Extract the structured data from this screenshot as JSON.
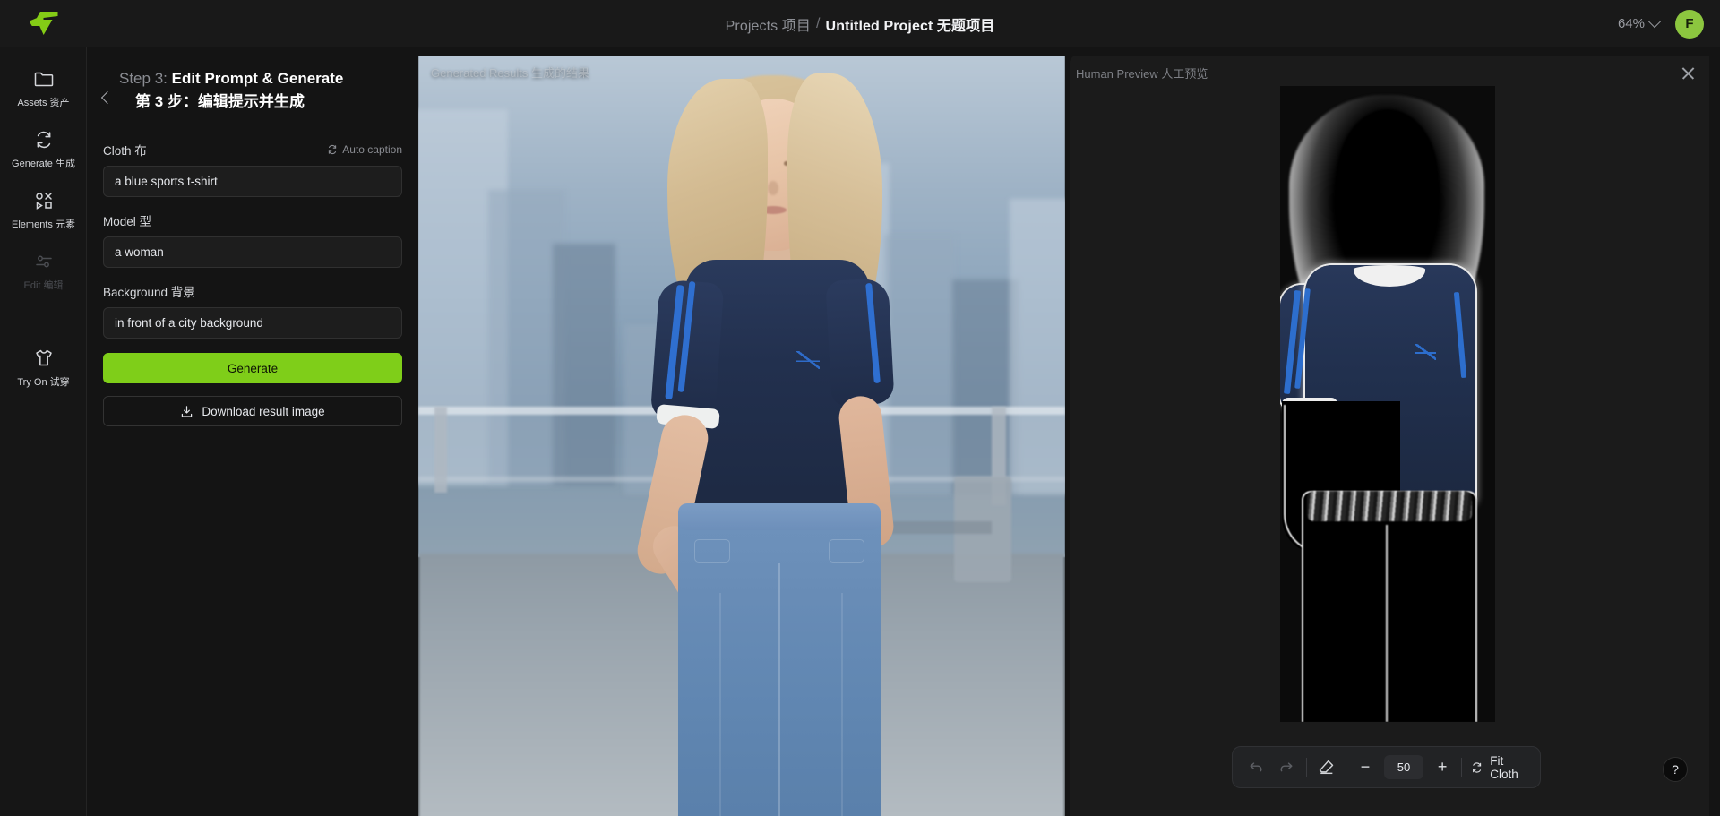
{
  "app": {
    "logo_name": "flux-logo"
  },
  "header": {
    "breadcrumb_projects": "Projects 项目",
    "breadcrumb_separator": "/",
    "breadcrumb_current": "Untitled Project 无题项目",
    "zoom_level": "64%",
    "avatar_initial": "F",
    "accent_color": "#8cc63f"
  },
  "sidebar": {
    "items": [
      {
        "label": "Assets 资产",
        "icon": "folder-icon",
        "disabled": false
      },
      {
        "label": "Generate 生成",
        "icon": "refresh-icon",
        "disabled": false
      },
      {
        "label": "Elements 元素",
        "icon": "shapes-icon",
        "disabled": false
      },
      {
        "label": "Edit 编辑",
        "icon": "sliders-icon",
        "disabled": true
      },
      {
        "label": "Try On 试穿",
        "icon": "tshirt-icon",
        "disabled": false
      }
    ]
  },
  "panel": {
    "step_prefix": "Step 3:",
    "step_title": "Edit Prompt & Generate",
    "step_title_cn": "第 3 步：编辑提示并生成",
    "back_icon": "chevron-left-icon",
    "fields": [
      {
        "label": "Cloth 布",
        "value": "a blue sports t-shirt",
        "action_label": "Auto caption",
        "action_icon": "refresh-icon"
      },
      {
        "label": "Model 型",
        "value": "a woman"
      },
      {
        "label": "Background 背景",
        "value": "in front of a city background"
      }
    ],
    "generate_label": "Generate",
    "generate_color": "#7fce19",
    "download_label": "Download result image",
    "download_icon": "download-icon"
  },
  "canvas": {
    "results_caption": "Generated Results 生成的结果"
  },
  "preview": {
    "caption": "Human Preview 人工预览",
    "close_icon": "close-icon"
  },
  "toolbar": {
    "undo_icon": "undo-icon",
    "redo_icon": "redo-icon",
    "eraser_icon": "eraser-icon",
    "minus_label": "−",
    "brush_size": "50",
    "plus_label": "+",
    "fit_label": "Fit Cloth",
    "fit_icon": "refresh-icon"
  },
  "help": {
    "label": "?"
  }
}
